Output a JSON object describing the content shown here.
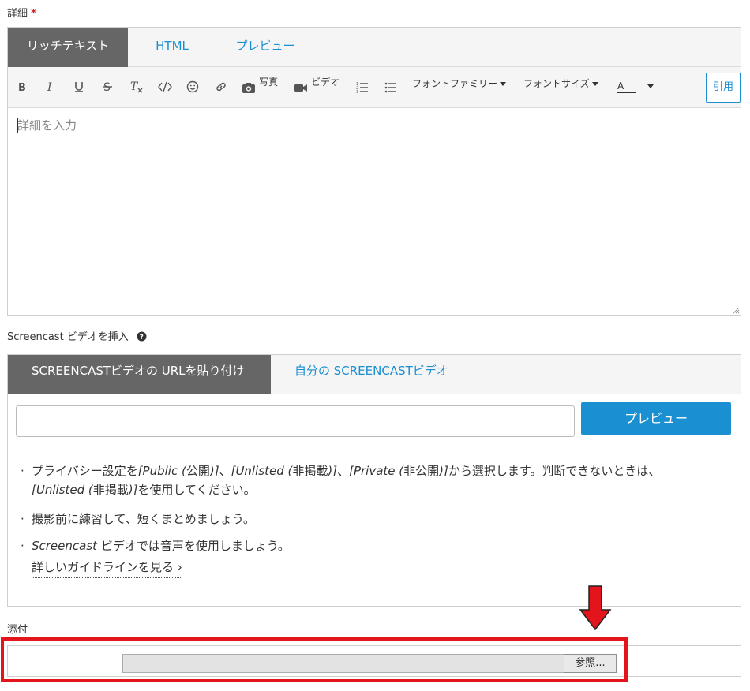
{
  "details": {
    "label": "詳細",
    "required": "*",
    "tabs": [
      {
        "label": "リッチテキスト",
        "active": true
      },
      {
        "label": "HTML",
        "active": false
      },
      {
        "label": "プレビュー",
        "active": false
      }
    ],
    "toolbar": {
      "photo": "写真",
      "video": "ビデオ",
      "font_family": "フォントファミリー",
      "font_size": "フォントサイズ",
      "font_color": "A",
      "quote": "引用"
    },
    "placeholder": "詳細を入力"
  },
  "screencast": {
    "label": "Screencast ビデオを挿入",
    "tabs": [
      {
        "label": "SCREENCASTビデオの URLを貼り付け",
        "active": true
      },
      {
        "label": "自分の SCREENCASTビデオ",
        "active": false
      }
    ],
    "url_value": "",
    "preview_button": "プレビュー",
    "bullet_symbol": "·",
    "tips": {
      "t1_a": "プライバシー設定を",
      "t1_b": "[Public (",
      "t1_c": "公開",
      "t1_d": ")]",
      "t1_e": "、",
      "t1_f": "[Unlisted (",
      "t1_g": "非掲載",
      "t1_h": ")]",
      "t1_i": "、",
      "t1_j": "[Private (",
      "t1_k": "非公開",
      "t1_l": ")]",
      "t1_m": "から選択します。判断できないときは、",
      "t1_n": "[Unlisted (",
      "t1_o": "非掲載",
      "t1_p": ")]",
      "t1_q": "を使用してください。",
      "t2": "撮影前に練習して、短くまとめましょう。",
      "t3_a": "Screencast",
      "t3_b": " ビデオでは音声を使用しましょう。"
    },
    "guide_link": "詳しいガイドラインを見る",
    "guide_arrow": "›"
  },
  "attachment": {
    "label": "添付",
    "file_path": "",
    "browse_button": "参照..."
  },
  "colors": {
    "accent": "#1a8fd1",
    "active_tab": "#666666",
    "highlight": "#e3141b"
  }
}
